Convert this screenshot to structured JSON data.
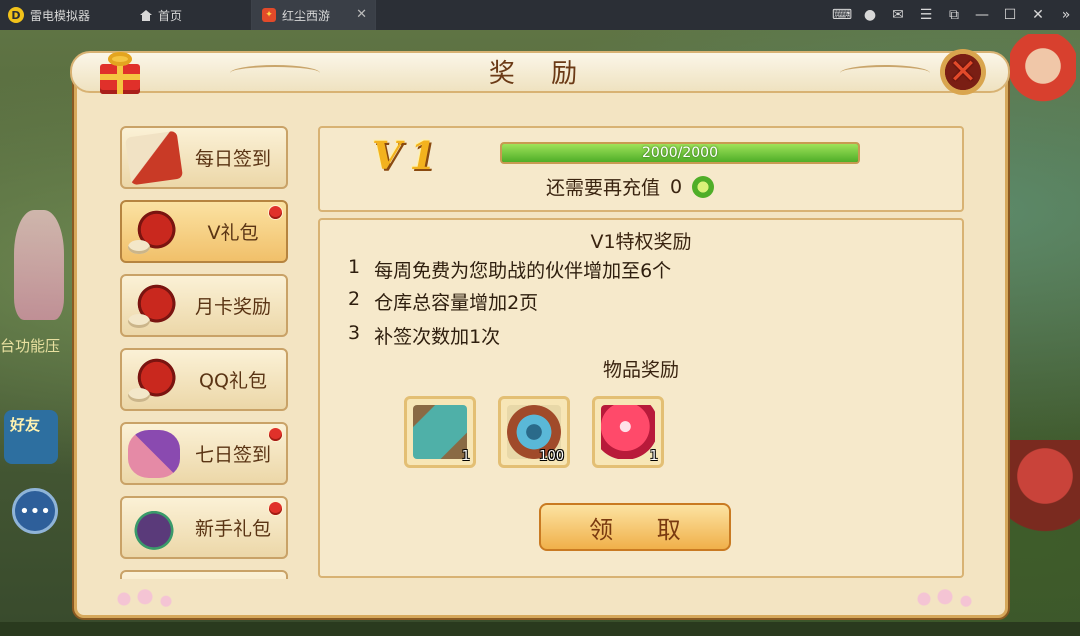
{
  "emulator": {
    "app_name": "雷电模拟器",
    "tabs": [
      {
        "label": "首页",
        "icon": "home-icon"
      },
      {
        "label": "红尘西游",
        "icon": "game-icon"
      }
    ],
    "tab_close_glyph": "✕",
    "window_controls": [
      "gamepad-icon",
      "user-icon",
      "mail-icon",
      "menu-icon",
      "popout-icon",
      "minimize-icon",
      "maximize-icon",
      "close-icon",
      "collapse-icon"
    ]
  },
  "background": {
    "left_text": "台功能压",
    "left_badge": "好友"
  },
  "panel": {
    "title": "奖 励",
    "close_glyph": "✕"
  },
  "sidebar": {
    "items": [
      {
        "label": "每日签到",
        "icon": "scroll-gift-icon",
        "active": false,
        "badge": false
      },
      {
        "label": "V礼包",
        "icon": "gift-basket-icon",
        "active": true,
        "badge": true
      },
      {
        "label": "月卡奖励",
        "icon": "gift-basket-icon",
        "active": false,
        "badge": false
      },
      {
        "label": "QQ礼包",
        "icon": "gift-basket-icon",
        "active": false,
        "badge": false
      },
      {
        "label": "七日签到",
        "icon": "scroll-icon",
        "active": false,
        "badge": true
      },
      {
        "label": "新手礼包",
        "icon": "jar-icon",
        "active": false,
        "badge": true
      }
    ]
  },
  "vip": {
    "level": "V1",
    "progress_text": "2000/2000",
    "progress_fraction": 1.0,
    "recharge_label": "还需要再充值",
    "recharge_amount": "0"
  },
  "privileges": {
    "title": "V1特权奖励",
    "lines": [
      {
        "num": "1",
        "text": "每周免费为您助战的伙伴增加至6个"
      },
      {
        "num": "2",
        "text": "仓库总容量增加2页"
      },
      {
        "num": "3",
        "text": "补签次数加1次"
      }
    ]
  },
  "item_rewards": {
    "title": "物品奖励",
    "items": [
      {
        "icon": "scroll-item-icon",
        "qty": "1"
      },
      {
        "icon": "crystal-item-icon",
        "qty": "100"
      },
      {
        "icon": "orb-item-icon",
        "qty": "1"
      }
    ]
  },
  "claim_button_label": "领 取",
  "colors": {
    "panel_bg": "#f3e4c2",
    "border_gold": "#d6a85b",
    "progress_green": "#4fae28",
    "badge_red": "#e0312a",
    "title_brown": "#6b3a16"
  }
}
